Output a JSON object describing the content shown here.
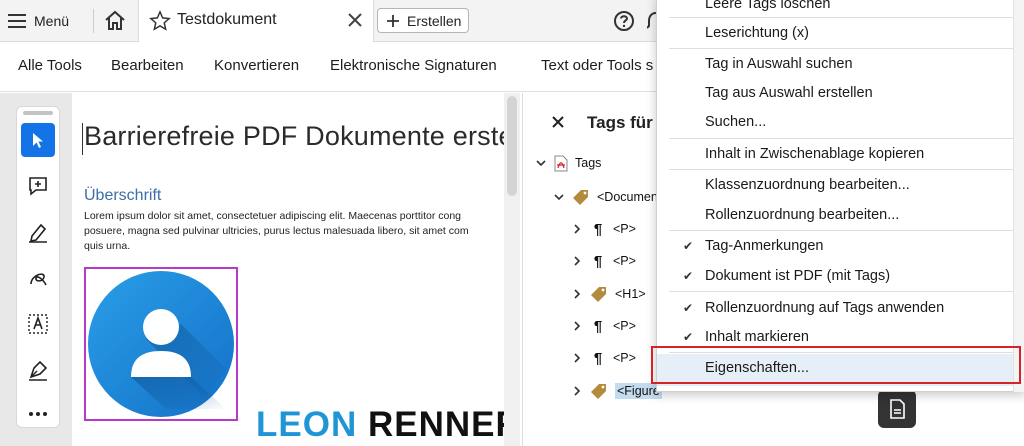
{
  "topbar": {
    "menu_label": "Menü",
    "tab_title": "Testdokument",
    "create_label": "Erstellen"
  },
  "toolbar": {
    "items": [
      "Alle Tools",
      "Bearbeiten",
      "Konvertieren",
      "Elektronische Signaturen",
      "Text oder Tools s"
    ]
  },
  "document": {
    "title": "Barrierefreie PDF Dokumente erste",
    "heading": "Überschrift",
    "body": "Lorem ipsum dolor sit amet, consectetuer adipiscing elit. Maecenas porttitor cong\nposuere, magna sed pulvinar ultricies, purus lectus malesuada libero, sit amet com\nquis urna.",
    "brand_part1": "LEON",
    "brand_part2": "RENNER"
  },
  "tags_panel": {
    "title": "Tags für",
    "rows": [
      "Tags",
      "<Documen",
      "<P>",
      "<P>",
      "<H1>",
      "<P>",
      "<P>",
      "<Figure"
    ]
  },
  "context_menu": {
    "items": [
      {
        "label": "Leere Tags löschen",
        "checked": false
      },
      {
        "label": "Leserichtung (x)",
        "checked": false
      },
      {
        "label": "Tag in Auswahl suchen",
        "checked": false
      },
      {
        "label": "Tag aus Auswahl erstellen",
        "checked": false
      },
      {
        "label": "Suchen...",
        "checked": false
      },
      {
        "label": "Inhalt in Zwischenablage kopieren",
        "checked": false
      },
      {
        "label": "Klassenzuordnung bearbeiten...",
        "checked": false
      },
      {
        "label": "Rollenzuordnung bearbeiten...",
        "checked": false
      },
      {
        "label": "Tag-Anmerkungen",
        "checked": true
      },
      {
        "label": "Dokument ist PDF (mit Tags)",
        "checked": true
      },
      {
        "label": "Rollenzuordnung auf Tags anwenden",
        "checked": true
      },
      {
        "label": "Inhalt markieren",
        "checked": true
      },
      {
        "label": "Eigenschaften...",
        "checked": false
      }
    ],
    "check_glyph": "✔"
  },
  "colors": {
    "accent": "#1473e6",
    "highlight_box": "#d6232a",
    "figure_box": "#b73ac8",
    "brand_blue": "#1f95d6"
  }
}
